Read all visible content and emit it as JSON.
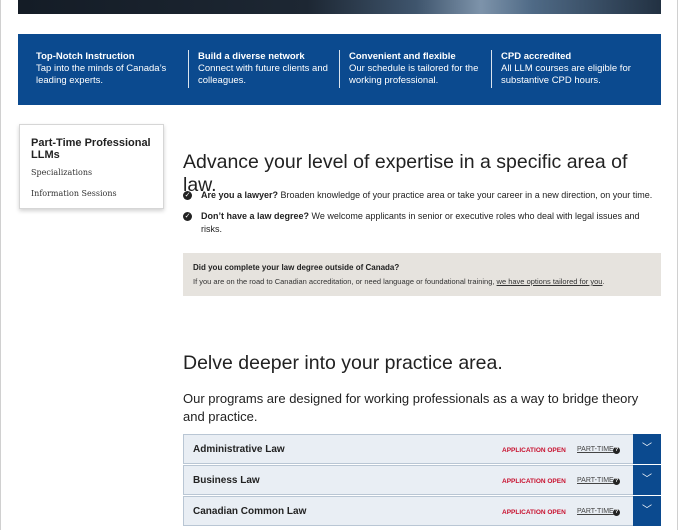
{
  "features": [
    {
      "title": "Top-Notch Instruction",
      "desc_line1": "Tap into the minds of Canada’s",
      "desc_line2": "leading experts."
    },
    {
      "title": "Build a diverse network",
      "desc_line1": "Connect with future clients and",
      "desc_line2": "colleagues."
    },
    {
      "title": "Convenient and flexible",
      "desc_line1": "Our schedule is tailored for the",
      "desc_line2": "working professional."
    },
    {
      "title": "CPD accredited",
      "desc_line1": "All LLM courses are eligible for",
      "desc_line2": "substantive CPD hours."
    }
  ],
  "sidenav": {
    "title": "Part-Time Professional LLMs",
    "links": [
      "Specializations",
      "Information Sessions"
    ]
  },
  "intro": {
    "heading": "Advance your level of expertise in a specific area of law.",
    "bullets": [
      {
        "bold": "Are you a lawyer?",
        "text": " Broaden knowledge of your practice area or take your career in a new direction, on your time."
      },
      {
        "bold": "Don’t have a law degree?",
        "text": " We welcome applicants in senior or executive roles who deal with legal issues and risks."
      }
    ]
  },
  "callout": {
    "title": "Did you complete your law degree outside of Canada?",
    "text": "If you are on the road to Canadian accreditation, or need language or foundational training, ",
    "link": "we have options tailored for you",
    "end": "."
  },
  "programs": {
    "heading": "Delve deeper into your practice area.",
    "lead": "Our programs are designed for working professionals as a way to bridge theory and practice.",
    "items": [
      {
        "name": "Administrative Law",
        "status": "APPLICATION OPEN",
        "type": "PART-TIME"
      },
      {
        "name": "Business Law",
        "status": "APPLICATION OPEN",
        "type": "PART-TIME"
      },
      {
        "name": "Canadian Common Law",
        "status": "APPLICATION OPEN",
        "type": "PART-TIME"
      }
    ]
  },
  "icons": {
    "check": "check-circle-icon",
    "help": "question-circle-icon",
    "expand": "chevron-down-icon"
  },
  "colors": {
    "brand_blue": "#0b4a8f",
    "status_red": "#c8102e",
    "callout_bg": "#e6e3de",
    "row_bg": "#e9eef4"
  }
}
